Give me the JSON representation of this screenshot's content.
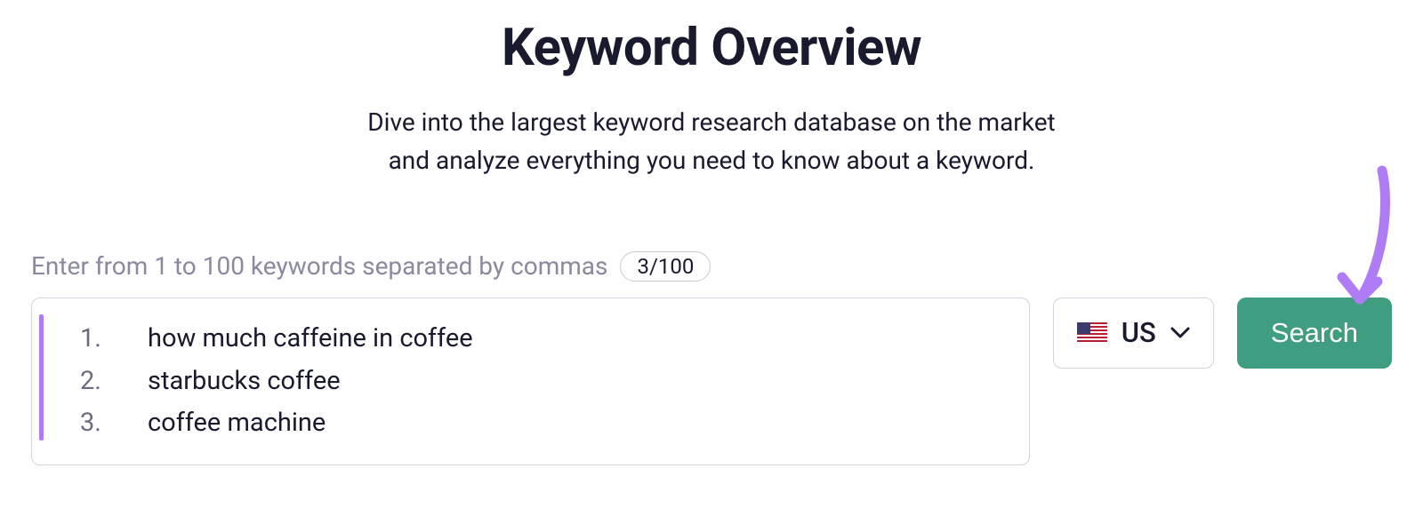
{
  "header": {
    "title": "Keyword Overview",
    "subtitle_line1": "Dive into the largest keyword research database on the market",
    "subtitle_line2": "and analyze everything you need to know about a keyword."
  },
  "input": {
    "label": "Enter from 1 to 100 keywords separated by commas",
    "count": "3/100",
    "keywords": [
      {
        "num": "1.",
        "text": "how much caffeine in coffee"
      },
      {
        "num": "2.",
        "text": "starbucks coffee"
      },
      {
        "num": "3.",
        "text": "coffee machine"
      }
    ]
  },
  "country": {
    "label": "US",
    "flag_icon": "us-flag-icon"
  },
  "search_button": "Search"
}
